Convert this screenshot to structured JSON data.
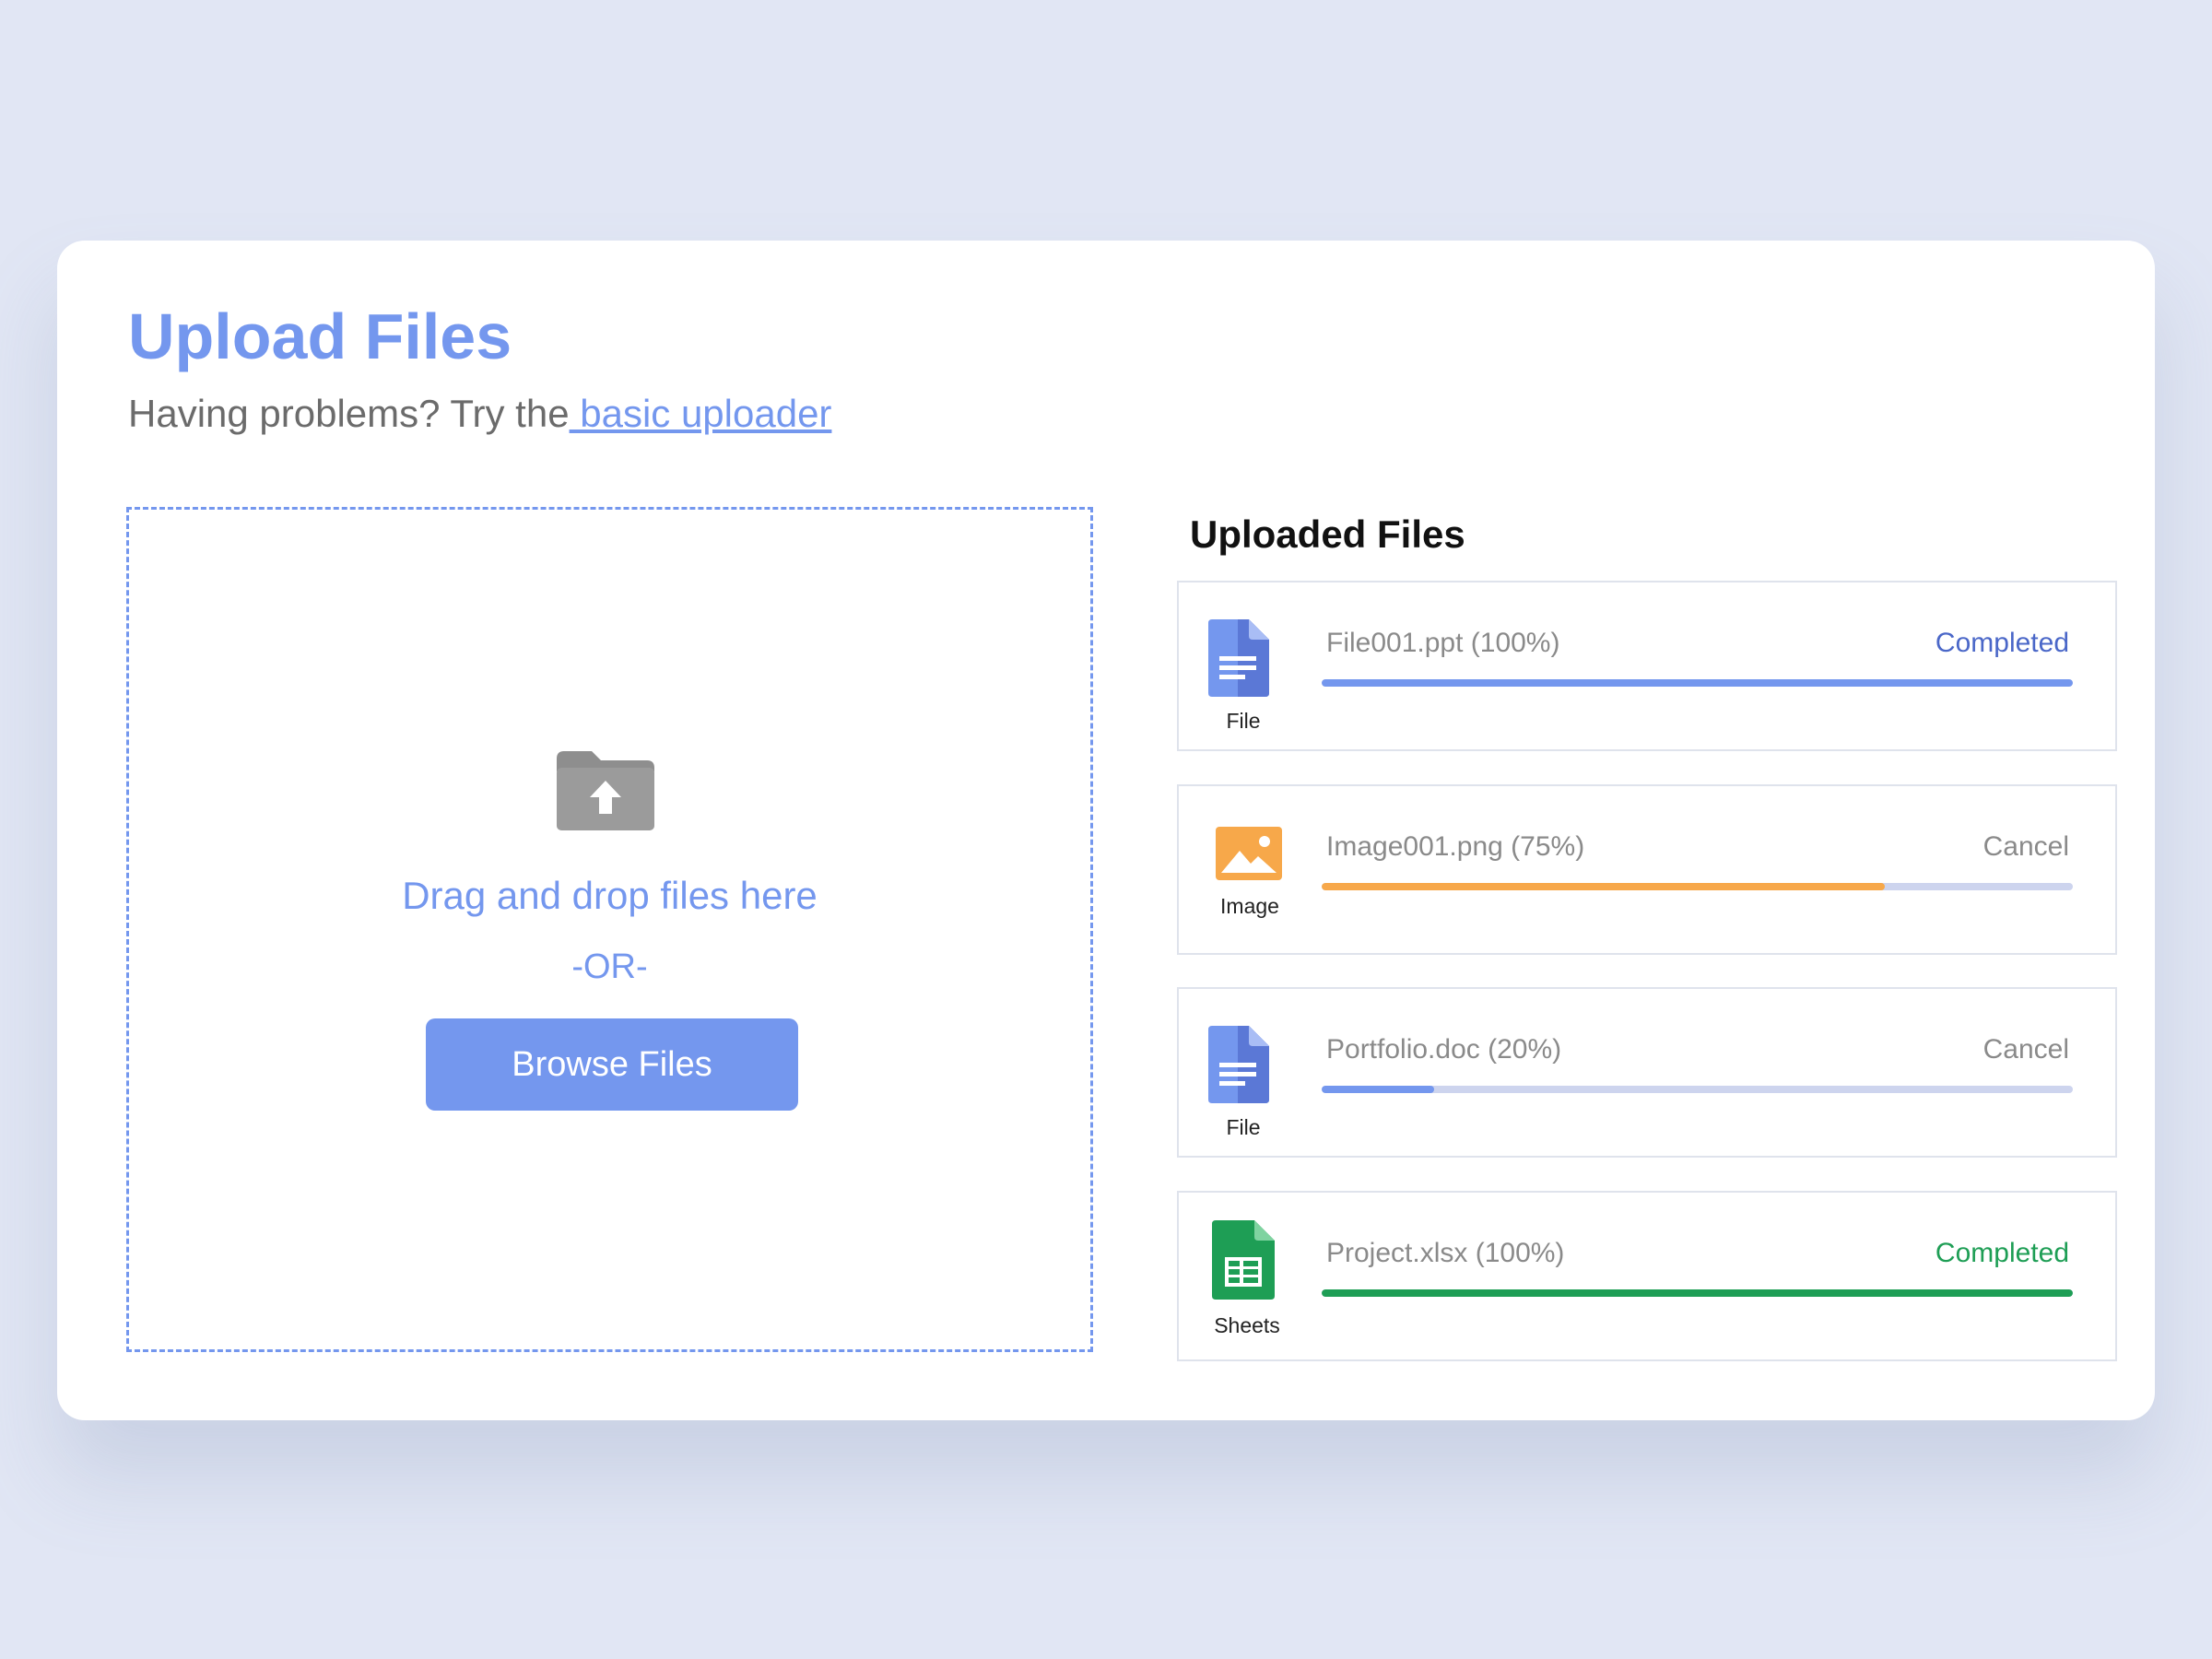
{
  "header": {
    "title": "Upload Files",
    "subtitle_prefix": "Having problems? Try the",
    "subtitle_link": " basic uploader"
  },
  "dropzone": {
    "icon": "folder-upload-icon",
    "drag_text": "Drag and drop files here",
    "or_text": "-OR-",
    "browse_label": "Browse Files"
  },
  "uploaded": {
    "title": "Uploaded Files",
    "files": [
      {
        "icon": "docs-file-icon",
        "icon_label": "File",
        "name": "File001.ppt (100%)",
        "status": "Completed",
        "progress": 1.0,
        "bar_color": "#7497ee",
        "status_color": "#4a67c8"
      },
      {
        "icon": "image-icon",
        "icon_label": "Image",
        "name": "Image001.png (75%)",
        "status": "Cancel",
        "progress": 0.75,
        "bar_color": "#f7a84a",
        "status_color": "#8a8a8a"
      },
      {
        "icon": "docs-file-icon",
        "icon_label": "File",
        "name": "Portfolio.doc (20%)",
        "status": "Cancel",
        "progress": 0.15,
        "bar_color": "#7497ee",
        "status_color": "#8a8a8a"
      },
      {
        "icon": "sheets-icon",
        "icon_label": "Sheets",
        "name": "Project.xlsx (100%)",
        "status": "Completed",
        "progress": 1.0,
        "bar_color": "#1e9e55",
        "status_color": "#1e9e55"
      }
    ]
  },
  "colors": {
    "background": "#e1e6f4",
    "accent": "#7497ee",
    "image_orange": "#f7a84a",
    "sheets_green": "#1e9e55"
  }
}
